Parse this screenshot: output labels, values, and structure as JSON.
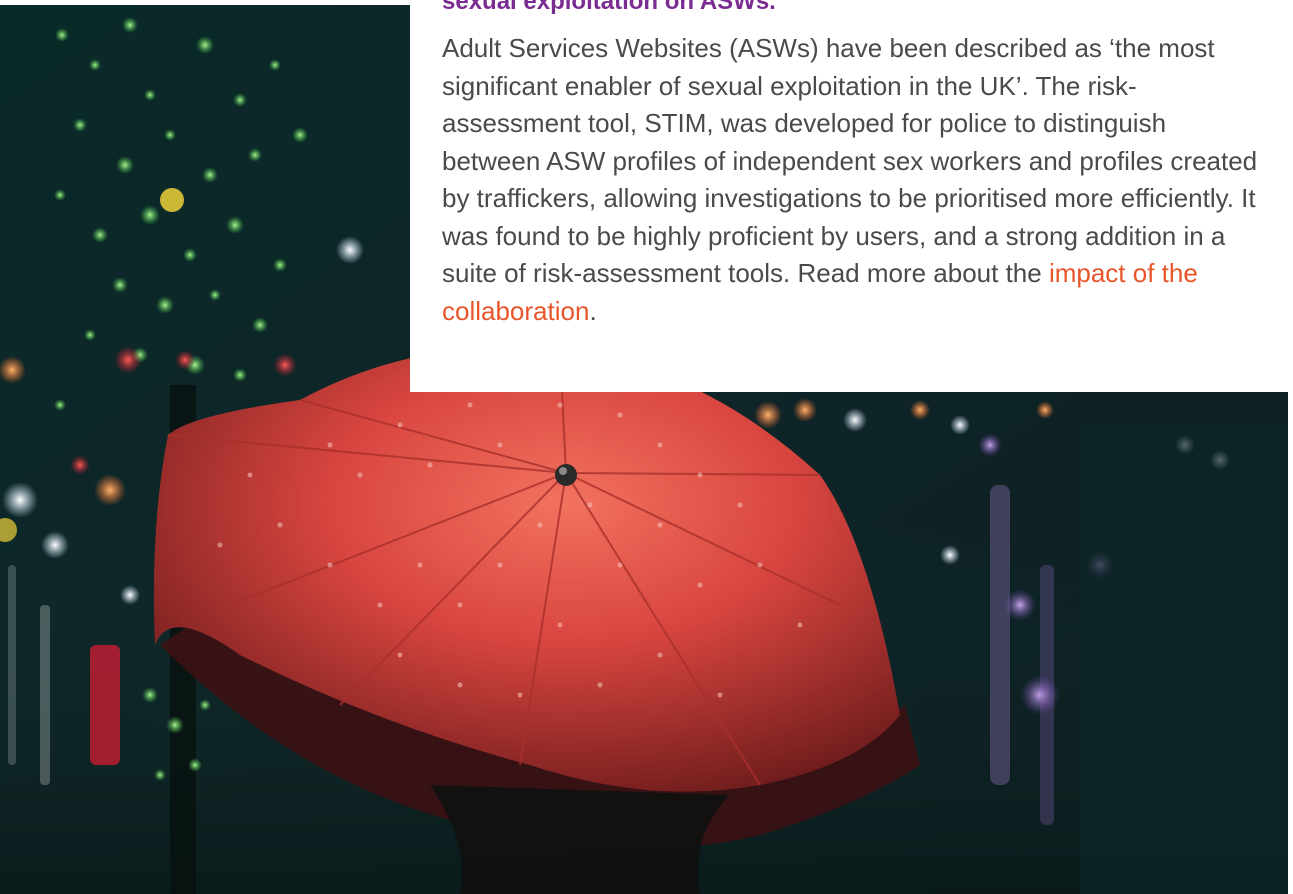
{
  "article": {
    "title": "sexual exploitation on ASWs.",
    "body_intro": "Adult Services Websites (ASWs) have been described as ‘the most significant enabler of sexual exploitation in the UK’. The risk-assessment tool, STIM, was developed for police to distinguish between ASW profiles of independent sex workers and profiles created by traffickers, allowing investigations to be prioritised more efficiently. It was found to be highly proficient by users, and a strong addition in a suite of risk-assessment tools. Read more about the ",
    "link_text": "impact of the collaboration",
    "body_end": "."
  },
  "colors": {
    "title": "#7b2c92",
    "body_text": "#4a4a4a",
    "link": "#e8552a",
    "umbrella": "#d8453f"
  },
  "image": {
    "subject": "red-umbrella-night-street-photo"
  }
}
